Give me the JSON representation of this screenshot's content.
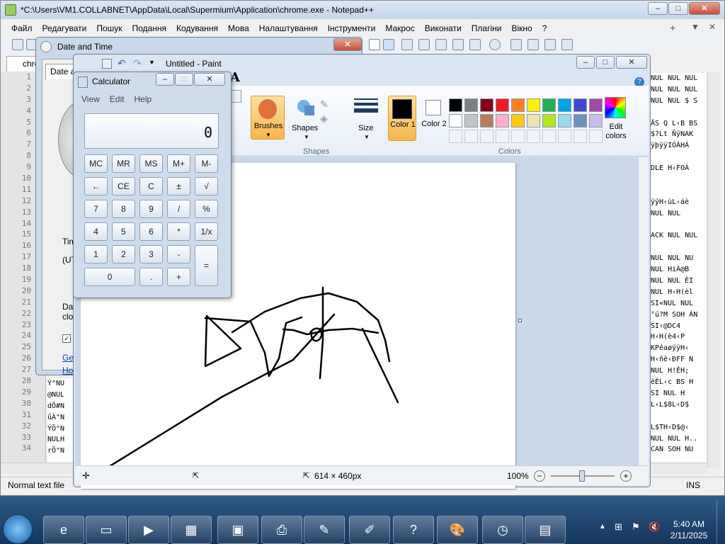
{
  "npp": {
    "title": "*C:\\Users\\VM1.COLLABNET\\AppData\\Local\\Supermium\\Application\\chrome.exe - Notepad++",
    "menu": [
      "Файл",
      "Редагувати",
      "Пошук",
      "Подання",
      "Кодування",
      "Мова",
      "Налаштування",
      "Інструменти",
      "Макрос",
      "Виконати",
      "Плагіни",
      "Вікно",
      "?"
    ],
    "tab": "chro",
    "lines": [
      "1",
      "2",
      "3",
      "4",
      "5",
      "6",
      "7",
      "8",
      "9",
      "10",
      "11",
      "12",
      "13",
      "14",
      "15",
      "16",
      "17",
      "18",
      "19",
      "20",
      "21",
      "22",
      "23",
      "24",
      "25",
      "26",
      "27",
      "28",
      "29",
      "30",
      "31",
      "32",
      "33",
      "34"
    ],
    "right_text": [
      "NUL NUL NUL",
      "NUL NUL NUL",
      "NUL NUL $ S",
      "",
      "ÂS Q L‹B BS",
      "$?Lt ÑÿNAK",
      "ÿþÿÿIÓÀHÁ",
      "",
      "DLE H‹FOÁ",
      "",
      "",
      "ÿÿH‹ùL‹áè",
      "NUL NUL",
      "",
      "ACK NUL NUL",
      "",
      "NUL NUL NU",
      "NUL HiÀ@B",
      "NUL NUL ÈI",
      "NUL H‹H(èl",
      "SI«NUL NUL",
      "°ú?M SOH ÁN",
      "SI‹@DC4",
      "H‹H(è4‹P",
      "KPéaøÿÿH‹",
      "H‹ñë‹ÐFF N",
      "NUL H!ÈH;",
      "ëÈL‹c BS H",
      "SI NUL H",
      "L‹L$8L‹D$",
      "",
      "L$TH‹D$@‹",
      "NUL NUL H..",
      "CAN SOH NU"
    ],
    "left_text": [
      "Ý\"NU",
      "@NUL",
      "dÕ#N",
      "ûÀ\"N",
      "ÝÕ\"N",
      "NULH",
      "rÕ\"N"
    ],
    "status": "Normal text file",
    "status_ins": "INS"
  },
  "datetime": {
    "title": "Date and Time",
    "tab": "Date a",
    "labels": [
      "Tim",
      "(UT",
      "Da",
      "clo"
    ],
    "links": [
      "Get",
      "Ho"
    ]
  },
  "paint": {
    "title": "Untitled - Paint",
    "groups": {
      "brushes": "Brushes",
      "shapes": "Shapes",
      "shapes_group": "Shapes",
      "size": "Size",
      "color1": "Color 1",
      "color2": "Color 2",
      "edit_colors": "Edit colors",
      "colors_group": "Colors"
    },
    "palette_row1": [
      "#000000",
      "#7f7f7f",
      "#880015",
      "#ed1c24",
      "#ff7f27",
      "#fff200",
      "#22b14c",
      "#00a2e8",
      "#3f48cc",
      "#a349a4"
    ],
    "palette_row2": [
      "#ffffff",
      "#c3c3c3",
      "#b97a57",
      "#ffaec9",
      "#ffc90e",
      "#efe4b0",
      "#b5e61d",
      "#99d9ea",
      "#7092be",
      "#c8bfe7"
    ],
    "color1": "#000000",
    "color2": "#ffffff",
    "canvas_size": "614 × 460px",
    "zoom": "100%"
  },
  "calc": {
    "title": "Calculator",
    "menu": [
      "View",
      "Edit",
      "Help"
    ],
    "display": "0",
    "rows": [
      [
        "MC",
        "MR",
        "MS",
        "M+",
        "M-"
      ],
      [
        "←",
        "CE",
        "C",
        "±",
        "√"
      ],
      [
        "7",
        "8",
        "9",
        "/",
        "%"
      ],
      [
        "4",
        "5",
        "6",
        "*",
        "1/x"
      ],
      [
        "1",
        "2",
        "3",
        "-",
        "="
      ],
      [
        "0",
        ".",
        "+"
      ]
    ]
  },
  "taskbar": {
    "time": "5:40 AM",
    "date": "2/11/2025"
  }
}
